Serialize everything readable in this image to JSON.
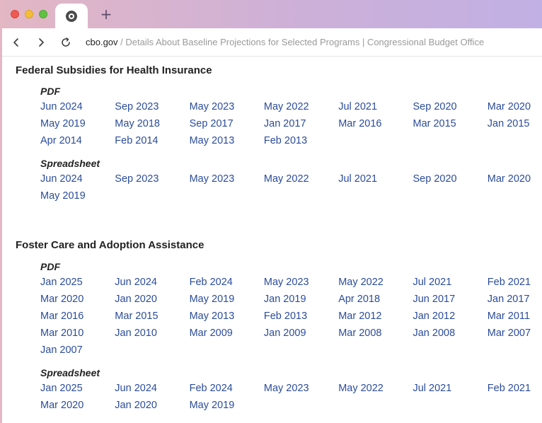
{
  "browser": {
    "new_tab_symbol": "+",
    "url_domain": "cbo.gov",
    "url_rest": " / Details About Baseline Projections for Selected Programs | Congressional Budget Office"
  },
  "colors": {
    "link": "#2b4c9b",
    "heading": "#222222"
  },
  "sections": [
    {
      "title": "Federal Subsidies for Health Insurance",
      "groups": [
        {
          "label": "PDF",
          "links": [
            "Jun 2024",
            "Sep 2023",
            "May 2023",
            "May 2022",
            "Jul 2021",
            "Sep 2020",
            "Mar 2020",
            "May 2019",
            "May 2018",
            "Sep 2017",
            "Jan 2017",
            "Mar 2016",
            "Mar 2015",
            "Jan 2015",
            "Apr 2014",
            "Feb 2014",
            "May 2013",
            "Feb 2013"
          ]
        },
        {
          "label": "Spreadsheet",
          "links": [
            "Jun 2024",
            "Sep 2023",
            "May 2023",
            "May 2022",
            "Jul 2021",
            "Sep 2020",
            "Mar 2020",
            "May 2019"
          ]
        }
      ]
    },
    {
      "title": "Foster Care and Adoption Assistance",
      "groups": [
        {
          "label": "PDF",
          "links": [
            "Jan 2025",
            "Jun 2024",
            "Feb 2024",
            "May 2023",
            "May 2022",
            "Jul 2021",
            "Feb 2021",
            "Mar 2020",
            "Jan 2020",
            "May 2019",
            "Jan 2019",
            "Apr 2018",
            "Jun 2017",
            "Jan 2017",
            "Mar 2016",
            "Mar 2015",
            "May 2013",
            "Feb 2013",
            "Mar 2012",
            "Jan 2012",
            "Mar 2011",
            "Mar 2010",
            "Jan 2010",
            "Mar 2009",
            "Jan 2009",
            "Mar 2008",
            "Jan 2008",
            "Mar 2007",
            "Jan 2007"
          ]
        },
        {
          "label": "Spreadsheet",
          "links": [
            "Jan 2025",
            "Jun 2024",
            "Feb 2024",
            "May 2023",
            "May 2022",
            "Jul 2021",
            "Feb 2021",
            "Mar 2020",
            "Jan 2020",
            "May 2019"
          ]
        }
      ]
    }
  ]
}
